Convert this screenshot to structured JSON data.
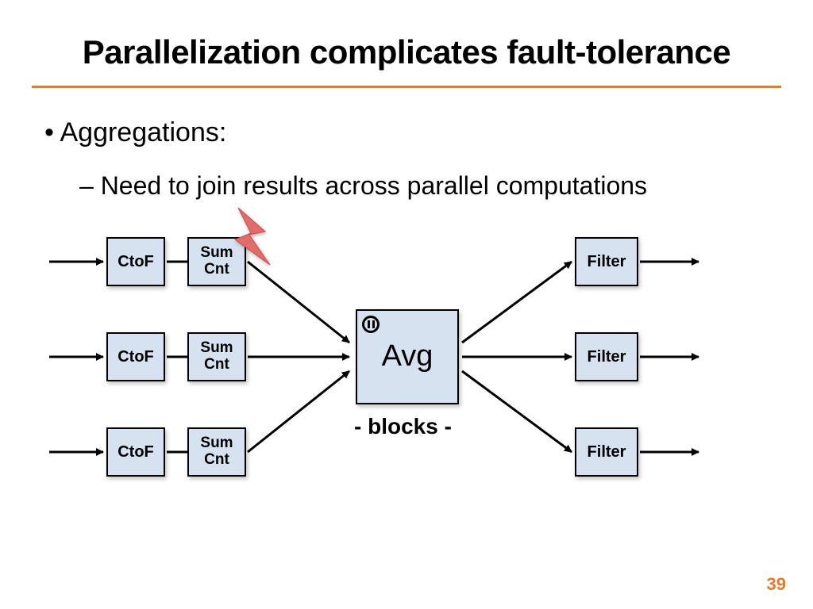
{
  "title": "Parallelization complicates fault-tolerance",
  "bullets": {
    "l1": "Aggregations:",
    "l2": "Need to join results across parallel computations"
  },
  "diagram": {
    "ctof": "CtoF",
    "sumcnt": "Sum\nCnt",
    "avg": "Avg",
    "filter": "Filter",
    "blocks": "- blocks -"
  },
  "page_number": "39",
  "colors": {
    "accent": "#e97828",
    "box_fill": "#d6e2ef",
    "bolt": "#e56a6a"
  }
}
